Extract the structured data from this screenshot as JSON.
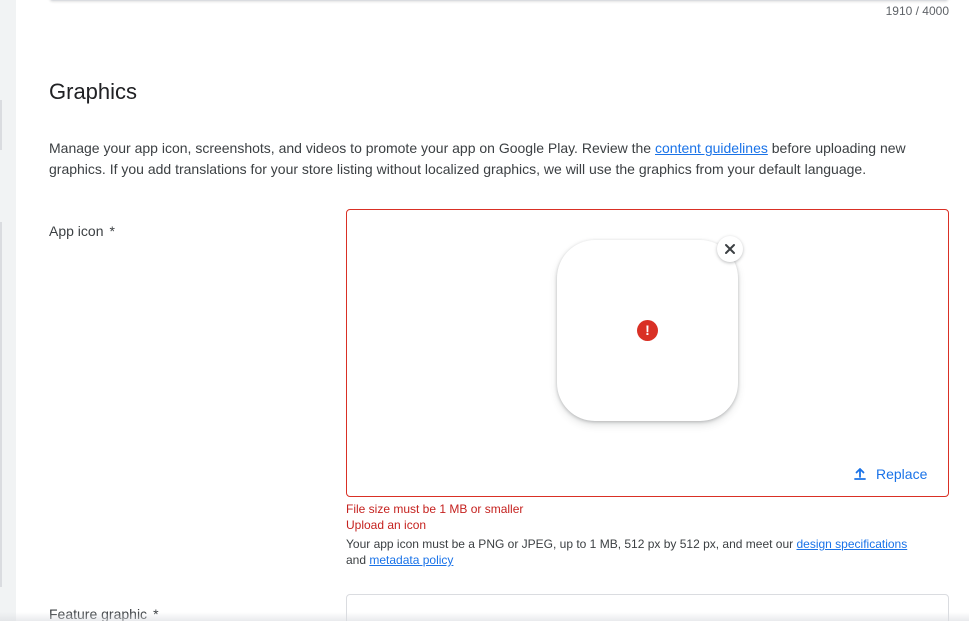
{
  "previous_field": {
    "char_counter": "1910 / 4000"
  },
  "graphics": {
    "title": "Graphics",
    "description_before_link": "Manage your app icon, screenshots, and videos to promote your app on Google Play. Review the ",
    "description_link": "content guidelines",
    "description_after_link": " before uploading new graphics. If you add translations for your store listing without localized graphics, we will use the graphics from your default language."
  },
  "app_icon": {
    "label": "App icon",
    "required_marker": "*",
    "status_icon": "error-icon",
    "error_glyph": "!",
    "remove_icon": "close-icon",
    "replace_icon": "upload-icon",
    "replace_label": "Replace",
    "errors": [
      "File size must be 1 MB or smaller",
      "Upload an icon"
    ],
    "help_before_link1": "Your app icon must be a PNG or JPEG, up to 1 MB, 512 px by 512 px, and meet our ",
    "help_link1": "design specifications",
    "help_between": " and ",
    "help_link2": "metadata policy"
  },
  "feature_graphic": {
    "label": "Feature graphic",
    "required_marker": "*"
  },
  "colors": {
    "error": "#d93025",
    "link": "#1a73e8",
    "text": "#202124"
  }
}
